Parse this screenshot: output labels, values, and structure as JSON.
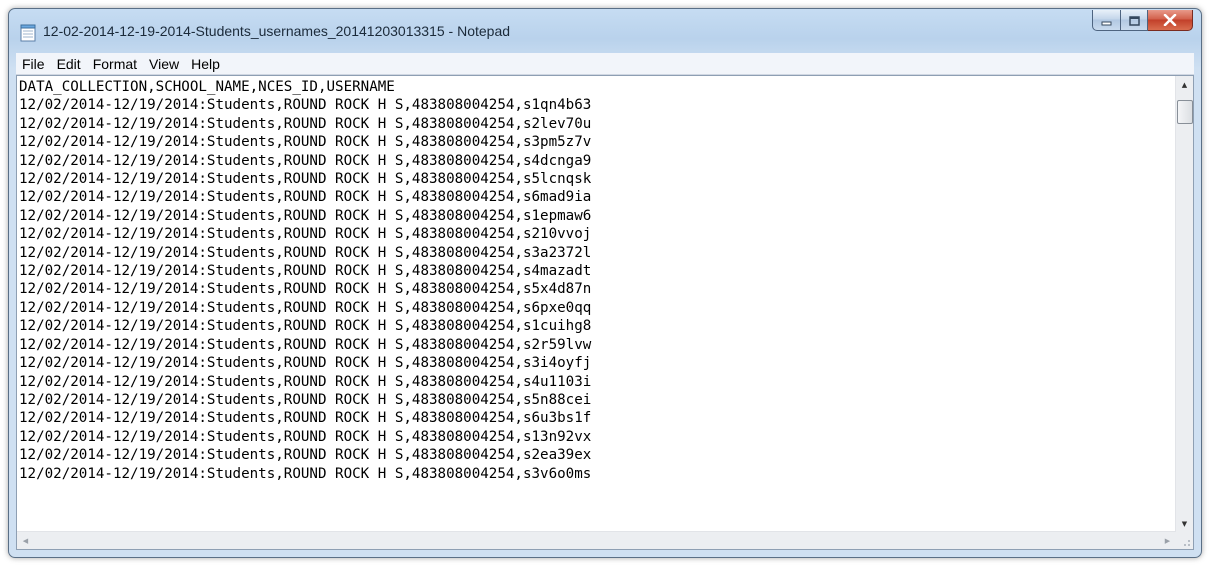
{
  "window": {
    "title": "12-02-2014-12-19-2014-Students_usernames_20141203013315 - Notepad",
    "icon": "notepad-icon"
  },
  "caption_buttons": {
    "minimize": "minimize-icon",
    "maximize": "maximize-icon",
    "close": "close-icon"
  },
  "menu": [
    "File",
    "Edit",
    "Format",
    "View",
    "Help"
  ],
  "document": {
    "lines": [
      "DATA_COLLECTION,SCHOOL_NAME,NCES_ID,USERNAME",
      "12/02/2014-12/19/2014:Students,ROUND ROCK H S,483808004254,s1qn4b63",
      "12/02/2014-12/19/2014:Students,ROUND ROCK H S,483808004254,s2lev70u",
      "12/02/2014-12/19/2014:Students,ROUND ROCK H S,483808004254,s3pm5z7v",
      "12/02/2014-12/19/2014:Students,ROUND ROCK H S,483808004254,s4dcnga9",
      "12/02/2014-12/19/2014:Students,ROUND ROCK H S,483808004254,s5lcnqsk",
      "12/02/2014-12/19/2014:Students,ROUND ROCK H S,483808004254,s6mad9ia",
      "12/02/2014-12/19/2014:Students,ROUND ROCK H S,483808004254,s1epmaw6",
      "12/02/2014-12/19/2014:Students,ROUND ROCK H S,483808004254,s210vvoj",
      "12/02/2014-12/19/2014:Students,ROUND ROCK H S,483808004254,s3a2372l",
      "12/02/2014-12/19/2014:Students,ROUND ROCK H S,483808004254,s4mazadt",
      "12/02/2014-12/19/2014:Students,ROUND ROCK H S,483808004254,s5x4d87n",
      "12/02/2014-12/19/2014:Students,ROUND ROCK H S,483808004254,s6pxe0qq",
      "12/02/2014-12/19/2014:Students,ROUND ROCK H S,483808004254,s1cuihg8",
      "12/02/2014-12/19/2014:Students,ROUND ROCK H S,483808004254,s2r59lvw",
      "12/02/2014-12/19/2014:Students,ROUND ROCK H S,483808004254,s3i4oyfj",
      "12/02/2014-12/19/2014:Students,ROUND ROCK H S,483808004254,s4u1103i",
      "12/02/2014-12/19/2014:Students,ROUND ROCK H S,483808004254,s5n88cei",
      "12/02/2014-12/19/2014:Students,ROUND ROCK H S,483808004254,s6u3bs1f",
      "12/02/2014-12/19/2014:Students,ROUND ROCK H S,483808004254,s13n92vx",
      "12/02/2014-12/19/2014:Students,ROUND ROCK H S,483808004254,s2ea39ex",
      "12/02/2014-12/19/2014:Students,ROUND ROCK H S,483808004254,s3v6o0ms"
    ]
  },
  "scrollbars": {
    "up": "scroll-up-icon",
    "down": "scroll-down-icon",
    "left": "scroll-left-icon",
    "right": "scroll-right-icon"
  }
}
